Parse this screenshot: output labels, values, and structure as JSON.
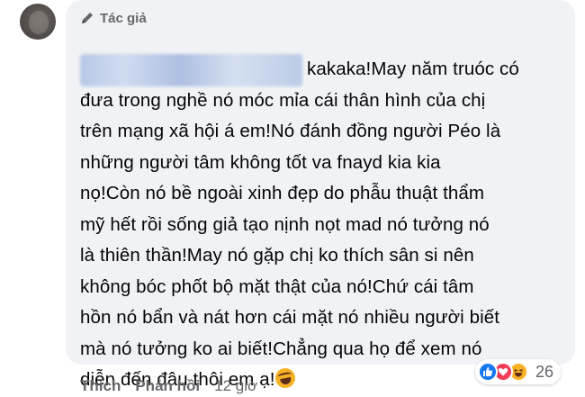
{
  "comment": {
    "badge_label": "Tác giả",
    "badge_icon": "pen-icon",
    "lines": [
      "kakaka!May năm truóc có",
      "đưa trong nghề nó móc mỉa cái thân hình của chị",
      "trên mạng xã hội á em!Nó đánh đồng người Péo là",
      "những người tâm không tốt va fnayd kia kia",
      "nọ!Còn nó bề ngoài xinh đẹp do phẫu thuật thẩm",
      "mỹ hết rồi sống giả tạo nịnh nọt mad nó tưởng nó",
      "là thiên thần!May nó gặp chị ko thích sân si nên",
      "không bóc phốt bộ mặt thật của nó!Chứ cái tâm",
      "hồn nó bẩn và nát hơn cái mặt nó nhiều người biết",
      "mà nó tưởng ko ai biết!Chẳng qua họ để xem nó",
      "diễn đến đâu thôi em ạ!"
    ],
    "trailing_emoji": "laughing-emoji"
  },
  "reactions": {
    "types": [
      "like",
      "love",
      "haha"
    ],
    "count": "26"
  },
  "actions": {
    "like_label": "Thích",
    "reply_label": "Phản hồi",
    "time": "12 giờ"
  },
  "colors": {
    "bubble": "#f0f2f5",
    "secondary_text": "#65676b",
    "like_blue": "#1877f2",
    "love_red": "#f33e58",
    "haha_yellow": "#f7b125"
  }
}
